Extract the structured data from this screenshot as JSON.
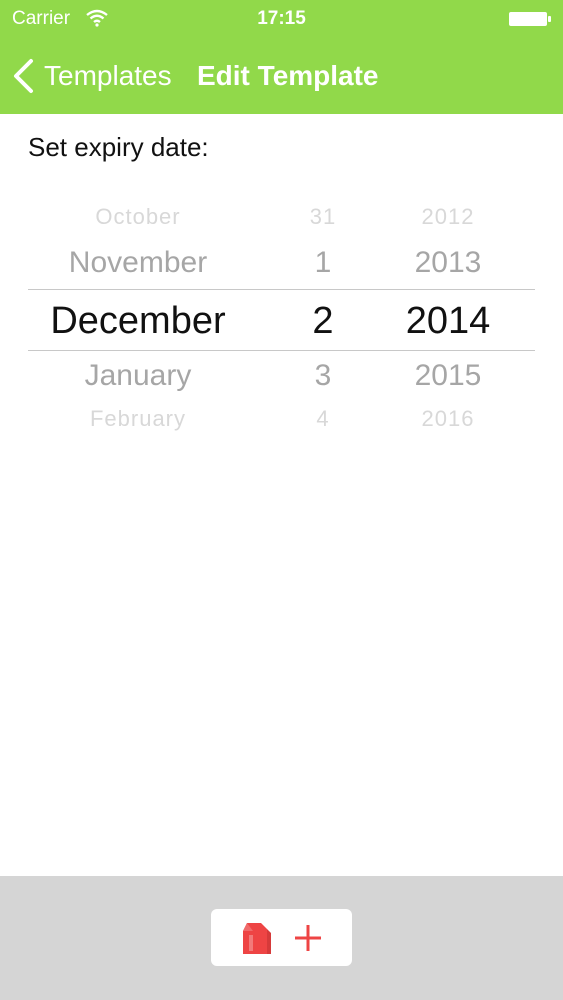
{
  "status_bar": {
    "carrier": "Carrier",
    "time": "17:15"
  },
  "nav": {
    "back_label": "Templates",
    "title": "Edit Template"
  },
  "content": {
    "prompt": "Set expiry date:"
  },
  "picker": {
    "months": [
      "October",
      "November",
      "December",
      "January",
      "February"
    ],
    "days": [
      "31",
      "1",
      "2",
      "3",
      "4"
    ],
    "years": [
      "2012",
      "2013",
      "2014",
      "2015",
      "2016"
    ],
    "selected": {
      "month": "December",
      "day": "2",
      "year": "2014"
    }
  },
  "colors": {
    "header": "#91d94a",
    "toolbar": "#d5d5d5",
    "accent_icon": "#ee4444"
  },
  "icons": {
    "back": "chevron-left-icon",
    "wifi": "wifi-icon",
    "battery": "battery-icon",
    "carton": "milk-carton-icon",
    "plus": "plus-icon"
  }
}
